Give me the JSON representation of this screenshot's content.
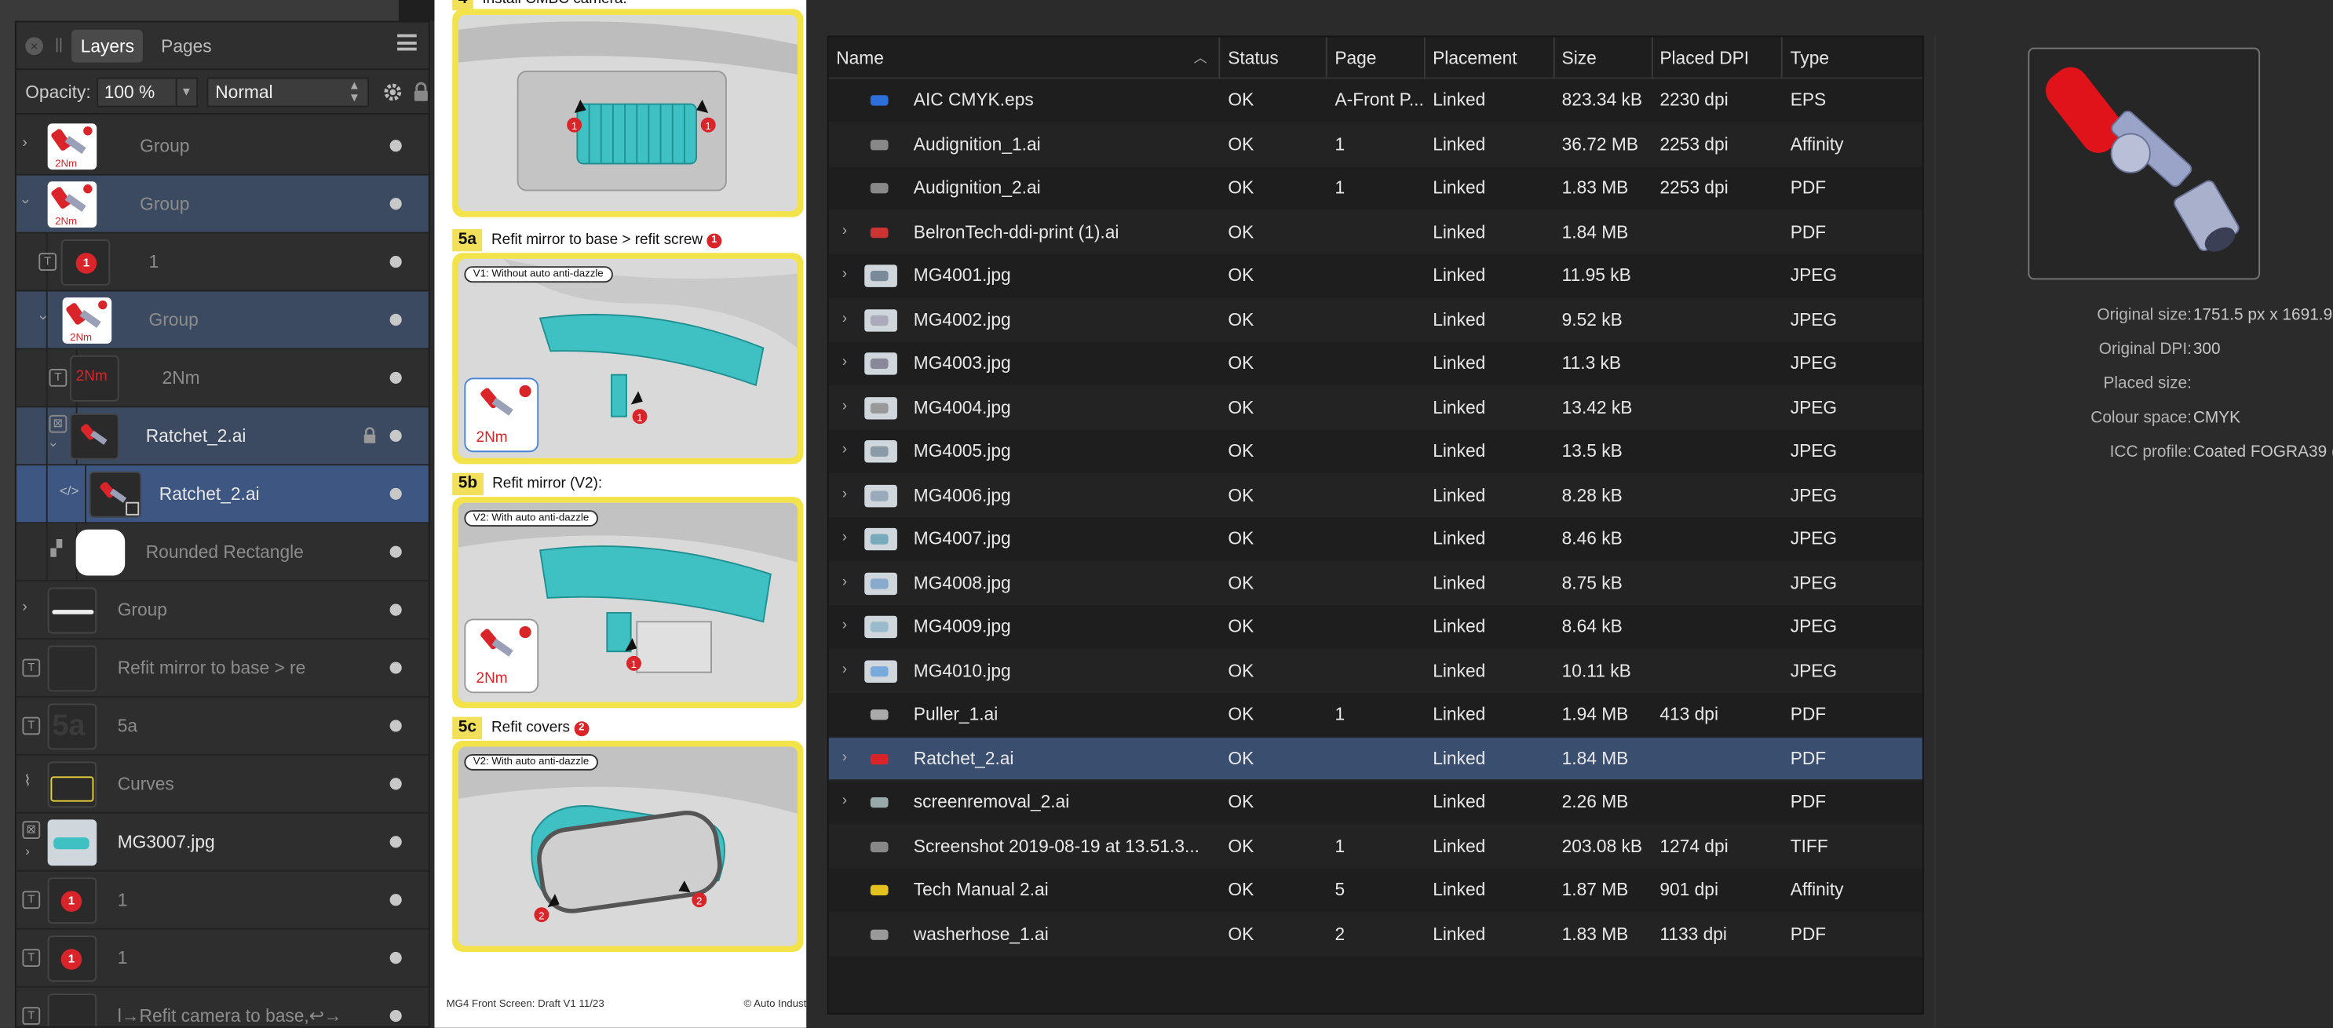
{
  "layers_panel": {
    "tabs": [
      "Layers",
      "Pages"
    ],
    "opacity_label": "Opacity:",
    "opacity_value": "100 %",
    "blend_mode": "Normal",
    "layers": [
      {
        "name": "Group"
      },
      {
        "name": "Group"
      },
      {
        "name": "1"
      },
      {
        "name": "Group"
      },
      {
        "name": "2Nm",
        "thumb_text": "2Nm"
      },
      {
        "name": "Ratchet_2.ai"
      },
      {
        "name": "Ratchet_2.ai"
      },
      {
        "name": "Rounded Rectangle"
      },
      {
        "name": "Group"
      },
      {
        "name": "Refit mirror to base > re"
      },
      {
        "name": "5a",
        "thumb_text": "5a"
      },
      {
        "name": "Curves"
      },
      {
        "name": "MG3007.jpg"
      },
      {
        "name": "1"
      },
      {
        "name": "1"
      },
      {
        "name": "l→Refit camera to base,↩→"
      }
    ],
    "thumb_label_2nm": "2Nm"
  },
  "document": {
    "step4_title": "Install CMBC camera:",
    "step5a": {
      "num": "5a",
      "title": "Refit mirror to base > refit screw",
      "badge": "1",
      "variant": "V1: Without auto anti-dazzle",
      "torque": "2Nm"
    },
    "step5b": {
      "num": "5b",
      "title": "Refit mirror (V2):",
      "variant": "V2: With auto anti-dazzle",
      "torque": "2Nm"
    },
    "step5c": {
      "num": "5c",
      "title": "Refit covers",
      "badge": "2",
      "variant": "V2: With auto anti-dazzle"
    },
    "callouts": [
      "1",
      "2"
    ],
    "footer_left": "MG4 Front Screen: Draft V1 11/23",
    "footer_right": "© Auto Indust"
  },
  "resources": {
    "columns": [
      "Name",
      "Status",
      "Page",
      "Placement",
      "Size",
      "Placed DPI",
      "Type"
    ],
    "rows": [
      {
        "name": "AIC CMYK.eps",
        "status": "OK",
        "page": "A-Front P...",
        "placement": "Linked",
        "size": "823.34 kB",
        "dpi": "2230 dpi",
        "type": "EPS",
        "expandable": false
      },
      {
        "name": "Audignition_1.ai",
        "status": "OK",
        "page": "1",
        "placement": "Linked",
        "size": "36.72 MB",
        "dpi": "2253 dpi",
        "type": "Affinity",
        "expandable": false
      },
      {
        "name": "Audignition_2.ai",
        "status": "OK",
        "page": "1",
        "placement": "Linked",
        "size": "1.83 MB",
        "dpi": "2253 dpi",
        "type": "PDF",
        "expandable": false
      },
      {
        "name": "BelronTech-ddi-print (1).ai",
        "status": "OK",
        "page": "",
        "placement": "Linked",
        "size": "1.84 MB",
        "dpi": "",
        "type": "PDF",
        "expandable": true
      },
      {
        "name": "MG4001.jpg",
        "status": "OK",
        "page": "",
        "placement": "Linked",
        "size": "11.95 kB",
        "dpi": "",
        "type": "JPEG",
        "expandable": true
      },
      {
        "name": "MG4002.jpg",
        "status": "OK",
        "page": "",
        "placement": "Linked",
        "size": "9.52 kB",
        "dpi": "",
        "type": "JPEG",
        "expandable": true
      },
      {
        "name": "MG4003.jpg",
        "status": "OK",
        "page": "",
        "placement": "Linked",
        "size": "11.3 kB",
        "dpi": "",
        "type": "JPEG",
        "expandable": true
      },
      {
        "name": "MG4004.jpg",
        "status": "OK",
        "page": "",
        "placement": "Linked",
        "size": "13.42 kB",
        "dpi": "",
        "type": "JPEG",
        "expandable": true
      },
      {
        "name": "MG4005.jpg",
        "status": "OK",
        "page": "",
        "placement": "Linked",
        "size": "13.5 kB",
        "dpi": "",
        "type": "JPEG",
        "expandable": true
      },
      {
        "name": "MG4006.jpg",
        "status": "OK",
        "page": "",
        "placement": "Linked",
        "size": "8.28 kB",
        "dpi": "",
        "type": "JPEG",
        "expandable": true
      },
      {
        "name": "MG4007.jpg",
        "status": "OK",
        "page": "",
        "placement": "Linked",
        "size": "8.46 kB",
        "dpi": "",
        "type": "JPEG",
        "expandable": true
      },
      {
        "name": "MG4008.jpg",
        "status": "OK",
        "page": "",
        "placement": "Linked",
        "size": "8.75 kB",
        "dpi": "",
        "type": "JPEG",
        "expandable": true
      },
      {
        "name": "MG4009.jpg",
        "status": "OK",
        "page": "",
        "placement": "Linked",
        "size": "8.64 kB",
        "dpi": "",
        "type": "JPEG",
        "expandable": true
      },
      {
        "name": "MG4010.jpg",
        "status": "OK",
        "page": "",
        "placement": "Linked",
        "size": "10.11 kB",
        "dpi": "",
        "type": "JPEG",
        "expandable": true
      },
      {
        "name": "Puller_1.ai",
        "status": "OK",
        "page": "1",
        "placement": "Linked",
        "size": "1.94 MB",
        "dpi": "413 dpi",
        "type": "PDF",
        "expandable": false
      },
      {
        "name": "Ratchet_2.ai",
        "status": "OK",
        "page": "",
        "placement": "Linked",
        "size": "1.84 MB",
        "dpi": "",
        "type": "PDF",
        "expandable": true,
        "selected": true
      },
      {
        "name": "screenremoval_2.ai",
        "status": "OK",
        "page": "",
        "placement": "Linked",
        "size": "2.26 MB",
        "dpi": "",
        "type": "PDF",
        "expandable": true
      },
      {
        "name": "Screenshot 2019-08-19 at 13.51.3...",
        "status": "OK",
        "page": "1",
        "placement": "Linked",
        "size": "203.08 kB",
        "dpi": "1274 dpi",
        "type": "TIFF",
        "expandable": false
      },
      {
        "name": "Tech Manual 2.ai",
        "status": "OK",
        "page": "5",
        "placement": "Linked",
        "size": "1.87 MB",
        "dpi": "901 dpi",
        "type": "Affinity",
        "expandable": false
      },
      {
        "name": "washerhose_1.ai",
        "status": "OK",
        "page": "2",
        "placement": "Linked",
        "size": "1.83 MB",
        "dpi": "1133 dpi",
        "type": "PDF",
        "expandable": false
      }
    ]
  },
  "info": {
    "original_size_label": "Original size:",
    "original_size": "1751.5 px x 1691.9",
    "original_dpi_label": "Original DPI:",
    "original_dpi": "300",
    "placed_size_label": "Placed size:",
    "placed_size": "",
    "colour_space_label": "Colour space:",
    "colour_space": "CMYK",
    "icc_label": "ICC profile:",
    "icc": "Coated FOGRA39 ("
  },
  "colors": {
    "selection": "#3a4e70",
    "layer_selection": "#3c4a61",
    "yellow_frame": "#f3e34a",
    "teal_part": "#3fc1c3",
    "badge_red": "#d9252a"
  }
}
